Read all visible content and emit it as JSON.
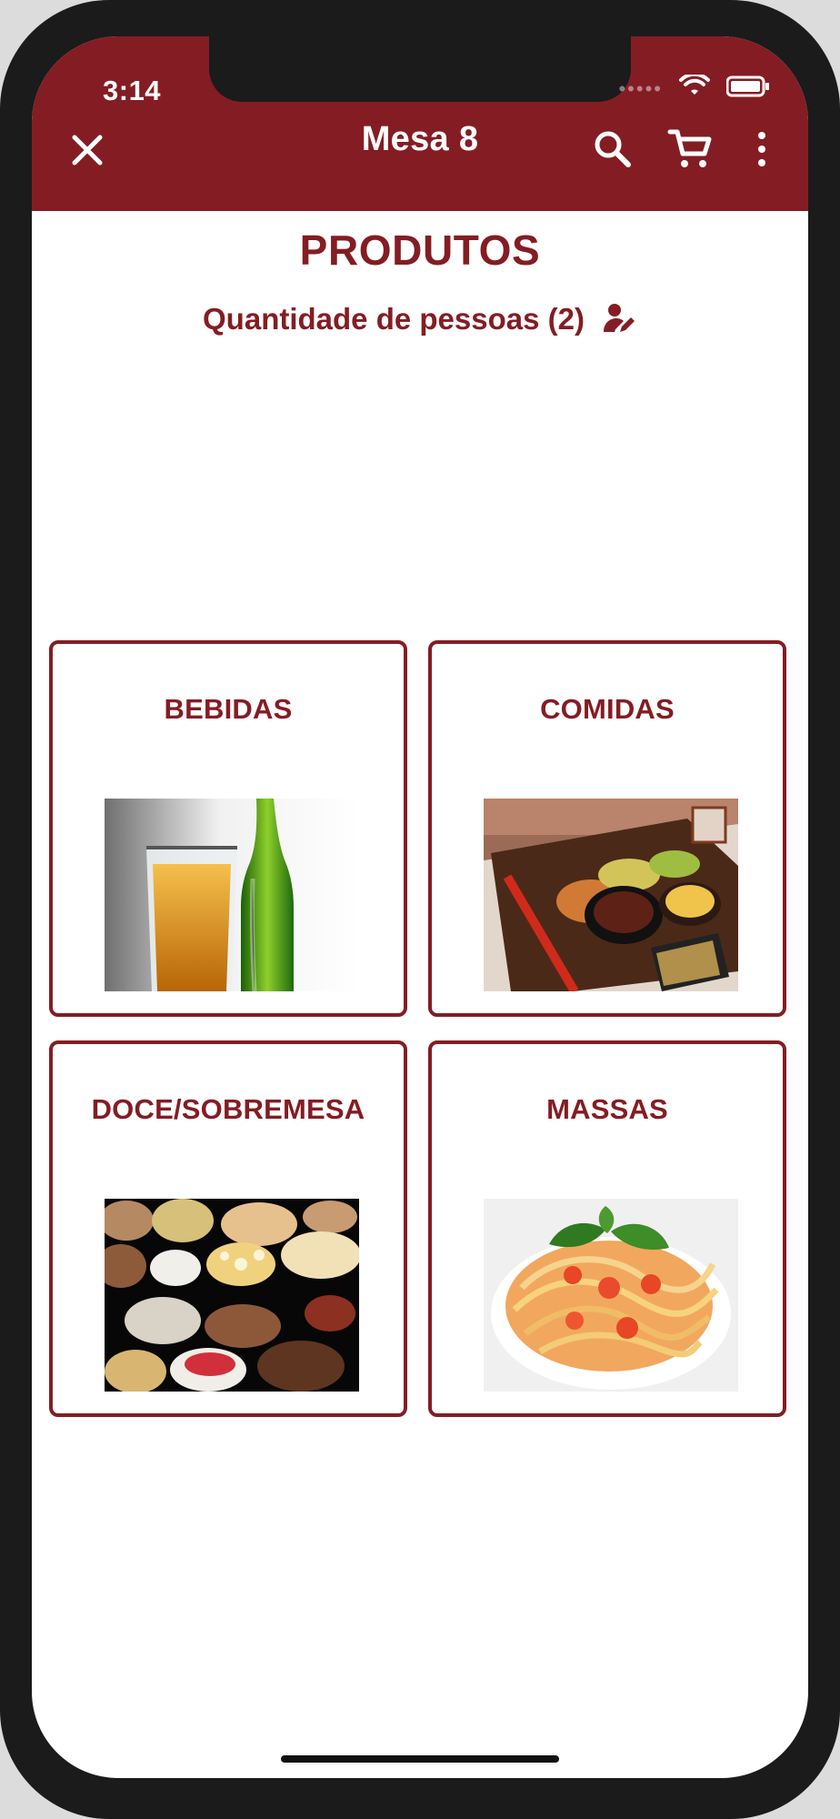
{
  "status_bar": {
    "time": "3:14"
  },
  "header": {
    "title": "Mesa  8",
    "buttons": {
      "close": "close-icon",
      "search": "search-icon",
      "cart": "cart-icon",
      "more": "more-icon"
    }
  },
  "page": {
    "title": "PRODUTOS",
    "people_label": "Quantidade de pessoas (2)"
  },
  "categories": [
    {
      "label": "BEBIDAS",
      "image": "drinks-image"
    },
    {
      "label": "COMIDAS",
      "image": "food-image"
    },
    {
      "label": "DOCE/SOBREMESA",
      "image": "desserts-image"
    },
    {
      "label": "MASSAS",
      "image": "pasta-image"
    }
  ],
  "colors": {
    "brand": "#841d23",
    "background": "#ffffff",
    "device": "#1b1b1b"
  }
}
